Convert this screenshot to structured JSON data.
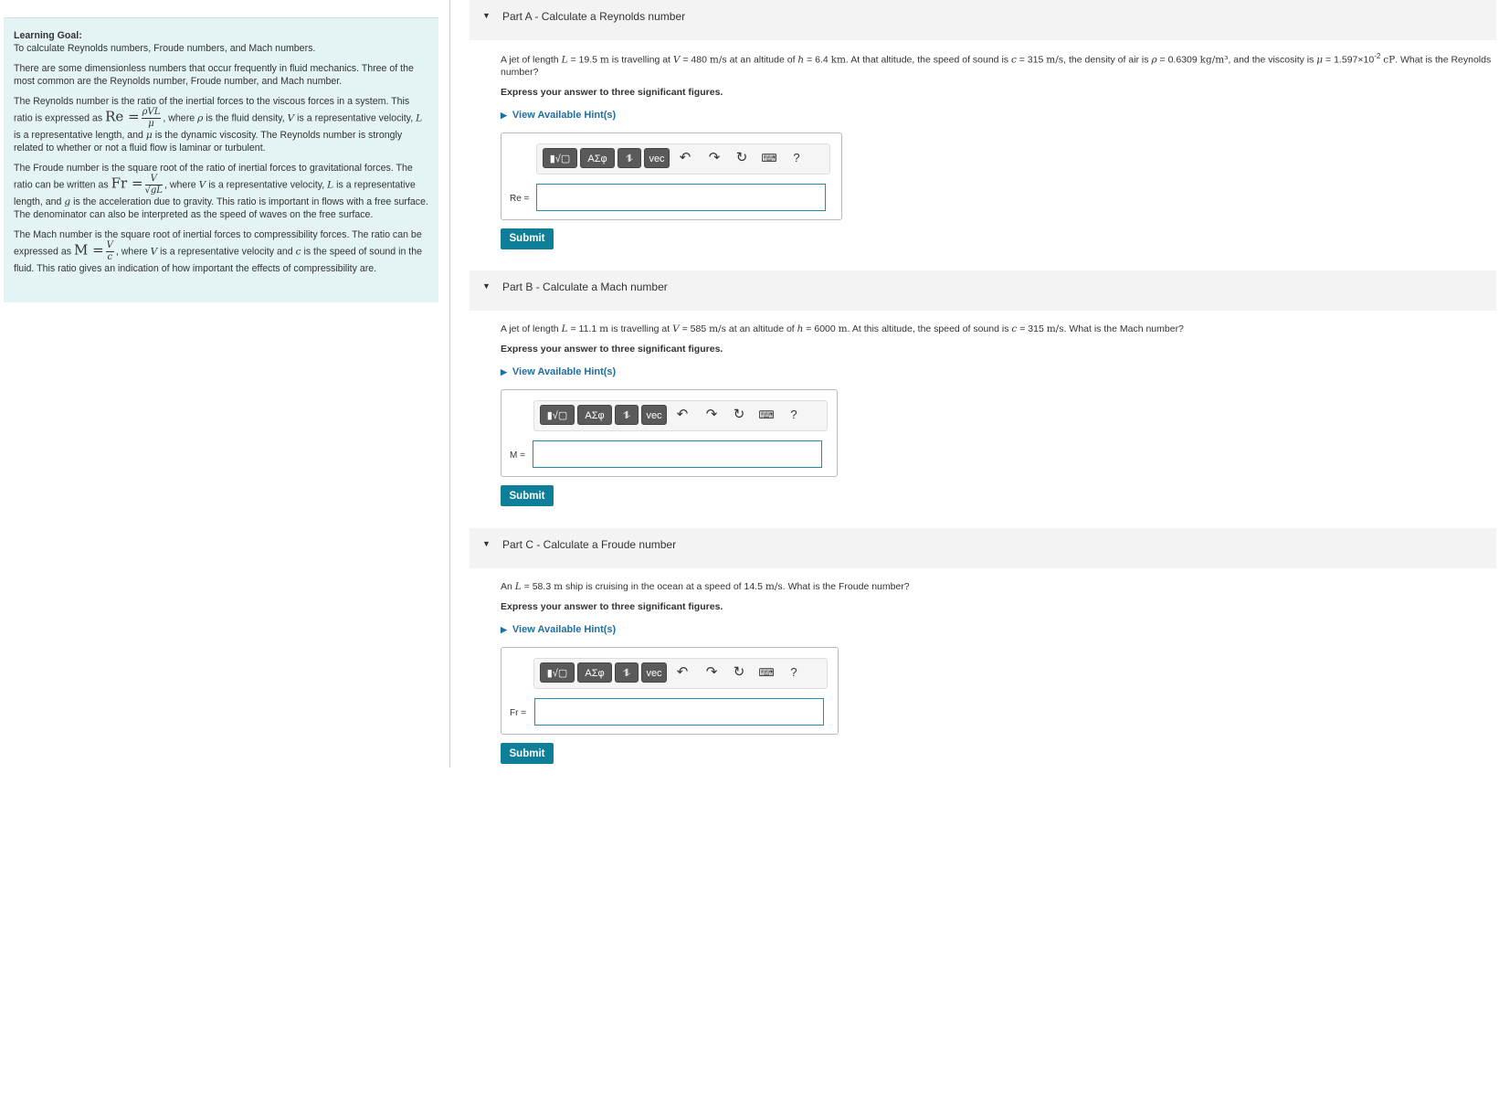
{
  "learning_goal": {
    "heading": "Learning Goal:",
    "goal": "To calculate Reynolds numbers, Froude numbers, and Mach numbers.",
    "intro": "There are some dimensionless numbers that occur frequently in fluid mechanics. Three of the most common are the Reynolds number, Froude number, and Mach number.",
    "reynolds": {
      "t1": "The Reynolds number is the ratio of the inertial forces to the viscous forces in a system. This ratio is expressed as ",
      "t2": ", where ",
      "t3": " is the fluid density, ",
      "t4": " is a representative velocity, ",
      "t5": " is a representative length, and ",
      "t6": " is the dynamic viscosity. The Reynolds number is strongly related to whether or not a fluid flow is laminar or turbulent."
    },
    "froude": {
      "t1": "The Froude number is the square root of the ratio of inertial forces to gravitational forces. The ratio can be written as ",
      "t2": ", where ",
      "t3": " is a representative velocity, ",
      "t4": " is a representative length, and ",
      "t5": " is the acceleration due to gravity. This ratio is important in flows with a free surface. The denominator can also be interpreted as the speed of waves on the free surface."
    },
    "mach": {
      "t1": "The Mach number is the square root of inertial forces to compressibility forces. The ratio can be expressed as ",
      "t2": ", where ",
      "t3": " is a representative velocity and ",
      "t4": " is the speed of sound in the fluid. This ratio gives an indication of how important the effects of compressibility are."
    }
  },
  "toolbar": {
    "templates": "▮√▢",
    "greek": "ΑΣφ",
    "arrows": "⥮",
    "vec": "vec",
    "help": "?"
  },
  "parts": {
    "a": {
      "title_prefix": "Part A",
      "title": " - Calculate a Reynolds number",
      "problem": {
        "p1": "A jet of length ",
        "L": "L",
        "p2": " = 19.5 ",
        "u1": "m",
        "p3": " is travelling at ",
        "V": "V",
        "p4": " = 480 ",
        "u2": "m/s",
        "p5": " at an altitude of ",
        "h": "h",
        "p6": " = 6.4 ",
        "u3": "km",
        "p7": ". At that altitude, the speed of sound is ",
        "c": "c",
        "p8": " = 315 ",
        "u4": "m/s",
        "p9": ", the density of air is ",
        "rho": "ρ",
        "p10": " = 0.6309 ",
        "u5": "kg/m³",
        "p11": ", and the viscosity is ",
        "mu": "μ",
        "p12": " = 1.597×10",
        "exp": "-2",
        "u6": "cP",
        "p13": ". What is the Reynolds number?"
      },
      "instruction": "Express your answer to three significant figures.",
      "hint": "View Available Hint(s)",
      "answer_label": "Re =",
      "answer_value": "",
      "submit": "Submit"
    },
    "b": {
      "title_prefix": "Part B",
      "title": " - Calculate a Mach number",
      "problem": {
        "p1": "A jet of length ",
        "L": "L",
        "p2": " = 11.1 ",
        "u1": "m",
        "p3": " is travelling at ",
        "V": "V",
        "p4": " = 585 ",
        "u2": "m/s",
        "p5": " at an altitude of ",
        "h": "h",
        "p6": " = 6000 ",
        "u3": "m",
        "p7": ". At this altitude, the speed of sound is ",
        "c": "c",
        "p8": " = 315 ",
        "u4": "m/s",
        "p9": ". What is the Mach number?"
      },
      "instruction": "Express your answer to three significant figures.",
      "hint": "View Available Hint(s)",
      "answer_label": "M =",
      "answer_value": "",
      "submit": "Submit"
    },
    "c": {
      "title_prefix": "Part C",
      "title": " - Calculate a Froude number",
      "problem": {
        "p1": "An ",
        "L": "L",
        "p2": " = 58.3 ",
        "u1": "m",
        "p3": " ship is cruising in the ocean at a speed of 14.5 ",
        "u2": "m/s",
        "p4": ". What is the Froude number?"
      },
      "instruction": "Express your answer to three significant figures.",
      "hint": "View Available Hint(s)",
      "answer_label": "Fr =",
      "answer_value": "",
      "submit": "Submit"
    }
  }
}
